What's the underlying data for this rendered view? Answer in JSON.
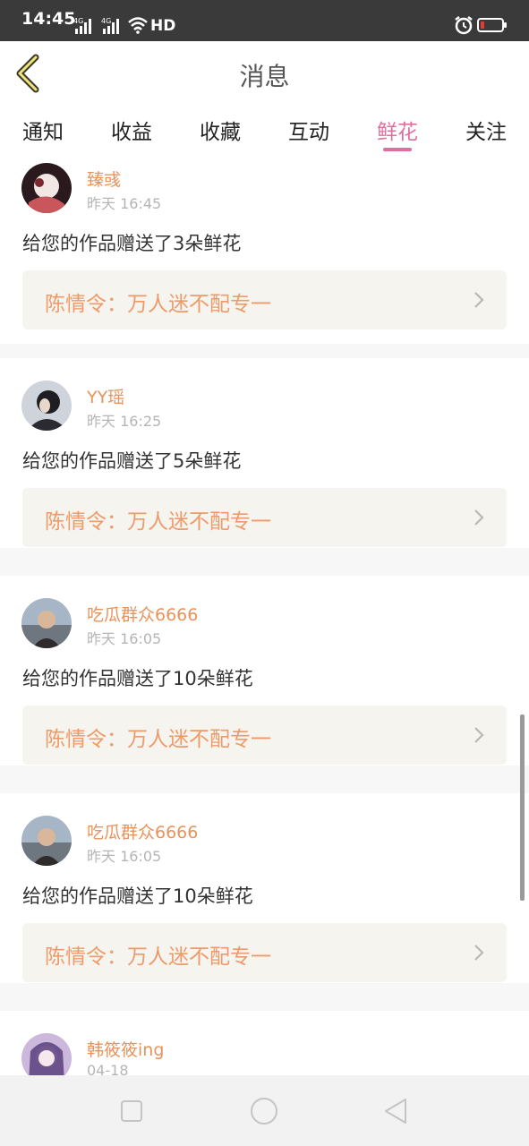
{
  "status": {
    "time": "14:45",
    "network1": "4G",
    "network2": "4G",
    "hd": "HD"
  },
  "header": {
    "title": "消息"
  },
  "tabs": [
    {
      "label": "通知"
    },
    {
      "label": "收益"
    },
    {
      "label": "收藏"
    },
    {
      "label": "互动"
    },
    {
      "label": "鲜花"
    },
    {
      "label": "关注"
    }
  ],
  "active_tab": "鲜花",
  "messages": [
    {
      "user": "臻彧",
      "time": "昨天 16:45",
      "text": "给您的作品赠送了3朵鲜花",
      "work": "陈情令：万人迷不配专一"
    },
    {
      "user": "YY瑶",
      "time": "昨天 16:25",
      "text": "给您的作品赠送了5朵鲜花",
      "work": "陈情令：万人迷不配专一"
    },
    {
      "user": "吃瓜群众6666",
      "time": "昨天 16:05",
      "text": "给您的作品赠送了10朵鲜花",
      "work": "陈情令：万人迷不配专一"
    },
    {
      "user": "吃瓜群众6666",
      "time": "昨天 16:05",
      "text": "给您的作品赠送了10朵鲜花",
      "work": "陈情令：万人迷不配专一"
    },
    {
      "user": "韩筱筱ing",
      "time": "04-18",
      "text": "",
      "work": ""
    }
  ],
  "colors": {
    "accent": "#e06ea0",
    "username": "#e8935a",
    "work_title": "#ef9a6a",
    "work_bg": "#f5f4ee"
  }
}
